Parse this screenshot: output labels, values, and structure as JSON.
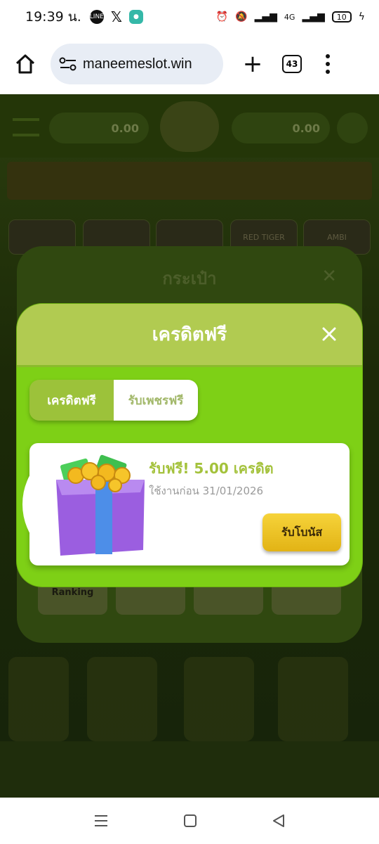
{
  "status": {
    "time": "19:39 น.",
    "network": "4G",
    "battery": "10"
  },
  "browser": {
    "url": "maneemeslot.win",
    "tab_count": "43"
  },
  "background": {
    "wallet_left": "0.00",
    "wallet_right": "0.00",
    "provider_1": "AMBI",
    "provider_2": "RED TIGER"
  },
  "wallet_modal": {
    "title": "กระเป๋า",
    "buttons": [
      "Ranking",
      "",
      "",
      ""
    ]
  },
  "free_credit": {
    "title": "เครดิตฟรี",
    "tabs": [
      {
        "label": "เครดิตฟรี",
        "active": true
      },
      {
        "label": "รับเพชรฟรี",
        "active": false
      }
    ],
    "card": {
      "title": "รับฟรี! 5.00 เครดิต",
      "expiry": "ใช้งานก่อน 31/01/2026",
      "claim_label": "รับโบนัส"
    }
  },
  "colors": {
    "header": "#b1cb51",
    "body": "#7ed016",
    "claim": "#f2c82a"
  }
}
